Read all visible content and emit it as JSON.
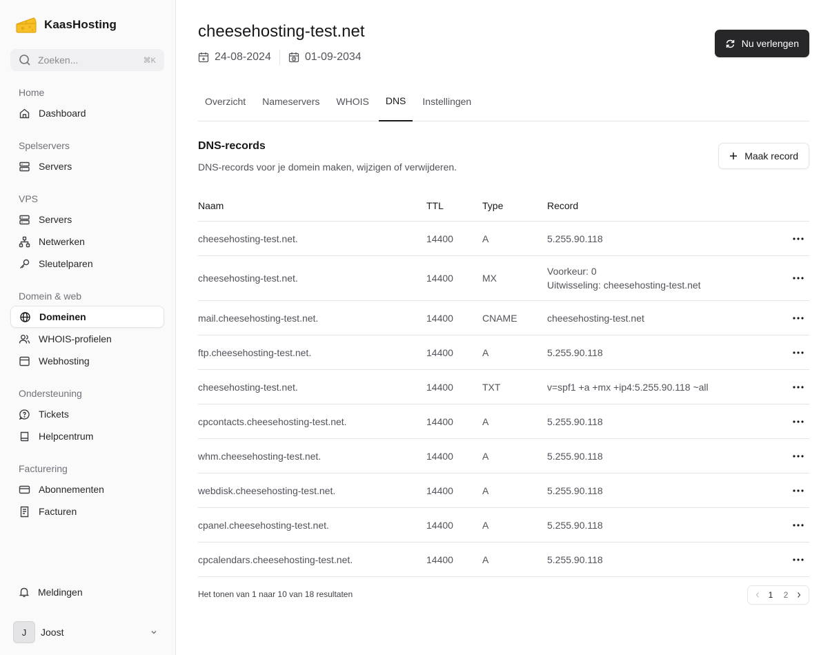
{
  "brand": {
    "name": "KaasHosting",
    "logo_icon": "cheese-icon"
  },
  "search": {
    "placeholder": "Zoeken...",
    "shortcut": "⌘K"
  },
  "sidebar": {
    "sections": [
      {
        "label": "Home",
        "items": [
          {
            "label": "Dashboard",
            "icon": "home-icon"
          }
        ]
      },
      {
        "label": "Spelservers",
        "items": [
          {
            "label": "Servers",
            "icon": "server-icon"
          }
        ]
      },
      {
        "label": "VPS",
        "items": [
          {
            "label": "Servers",
            "icon": "server-icon"
          },
          {
            "label": "Netwerken",
            "icon": "network-icon"
          },
          {
            "label": "Sleutelparen",
            "icon": "key-icon"
          }
        ]
      },
      {
        "label": "Domein & web",
        "items": [
          {
            "label": "Domeinen",
            "icon": "globe-icon",
            "active": true
          },
          {
            "label": "WHOIS-profielen",
            "icon": "users-icon"
          },
          {
            "label": "Webhosting",
            "icon": "browser-icon"
          }
        ]
      },
      {
        "label": "Ondersteuning",
        "items": [
          {
            "label": "Tickets",
            "icon": "chat-help-icon"
          },
          {
            "label": "Helpcentrum",
            "icon": "book-icon"
          }
        ]
      },
      {
        "label": "Facturering",
        "items": [
          {
            "label": "Abonnementen",
            "icon": "credit-card-icon"
          },
          {
            "label": "Facturen",
            "icon": "receipt-icon"
          }
        ]
      }
    ],
    "notifications_label": "Meldingen",
    "user": {
      "initial": "J",
      "name": "Joost"
    }
  },
  "header": {
    "title": "cheesehosting-test.net",
    "registered_date": "24-08-2024",
    "expiry_date": "01-09-2034",
    "renew_label": "Nu verlengen"
  },
  "tabs": [
    {
      "label": "Overzicht",
      "active": false
    },
    {
      "label": "Nameservers",
      "active": false
    },
    {
      "label": "WHOIS",
      "active": false
    },
    {
      "label": "DNS",
      "active": true
    },
    {
      "label": "Instellingen",
      "active": false
    }
  ],
  "dns": {
    "title": "DNS-records",
    "description": "DNS-records voor je domein maken, wijzigen of verwijderen.",
    "create_label": "Maak record",
    "columns": {
      "name": "Naam",
      "ttl": "TTL",
      "type": "Type",
      "record": "Record"
    },
    "records": [
      {
        "name": "cheesehosting-test.net.",
        "ttl": "14400",
        "type": "A",
        "record": [
          "5.255.90.118"
        ]
      },
      {
        "name": "cheesehosting-test.net.",
        "ttl": "14400",
        "type": "MX",
        "record": [
          "Voorkeur: 0",
          "Uitwisseling: cheesehosting-test.net"
        ]
      },
      {
        "name": "mail.cheesehosting-test.net.",
        "ttl": "14400",
        "type": "CNAME",
        "record": [
          "cheesehosting-test.net"
        ]
      },
      {
        "name": "ftp.cheesehosting-test.net.",
        "ttl": "14400",
        "type": "A",
        "record": [
          "5.255.90.118"
        ]
      },
      {
        "name": "cheesehosting-test.net.",
        "ttl": "14400",
        "type": "TXT",
        "record": [
          "v=spf1 +a +mx +ip4:5.255.90.118 ~all"
        ]
      },
      {
        "name": "cpcontacts.cheesehosting-test.net.",
        "ttl": "14400",
        "type": "A",
        "record": [
          "5.255.90.118"
        ]
      },
      {
        "name": "whm.cheesehosting-test.net.",
        "ttl": "14400",
        "type": "A",
        "record": [
          "5.255.90.118"
        ]
      },
      {
        "name": "webdisk.cheesehosting-test.net.",
        "ttl": "14400",
        "type": "A",
        "record": [
          "5.255.90.118"
        ]
      },
      {
        "name": "cpanel.cheesehosting-test.net.",
        "ttl": "14400",
        "type": "A",
        "record": [
          "5.255.90.118"
        ]
      },
      {
        "name": "cpcalendars.cheesehosting-test.net.",
        "ttl": "14400",
        "type": "A",
        "record": [
          "5.255.90.118"
        ]
      }
    ],
    "results_text": "Het tonen van 1 naar 10 van 18 resultaten",
    "pages": [
      "1",
      "2"
    ],
    "current_page": "1"
  }
}
